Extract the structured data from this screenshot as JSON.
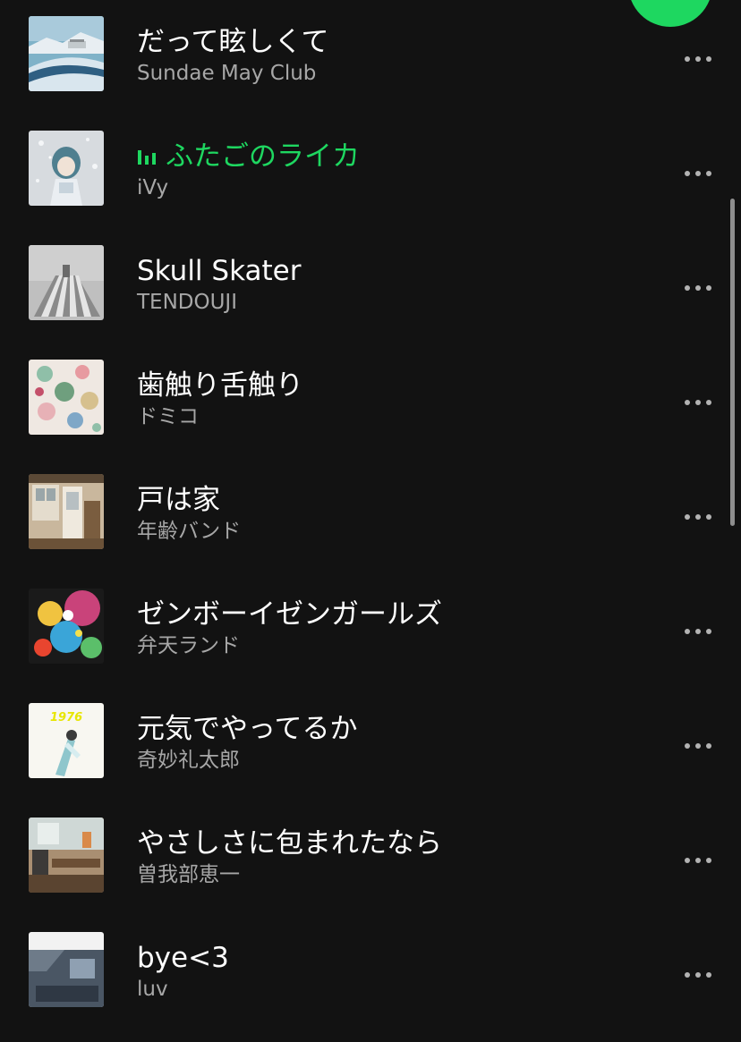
{
  "colors": {
    "background": "#121212",
    "accent": "#1ed760",
    "title": "#ffffff",
    "artist": "#a7a7a7"
  },
  "tracks": [
    {
      "title": "だって眩しくて",
      "artist": "Sundae May Club",
      "playing": false
    },
    {
      "title": "ふたごのライカ",
      "artist": "iVy",
      "playing": true
    },
    {
      "title": "Skull Skater",
      "artist": "TENDOUJI",
      "playing": false
    },
    {
      "title": "歯触り舌触り",
      "artist": "ドミコ",
      "playing": false
    },
    {
      "title": "戸は家",
      "artist": "年齢バンド",
      "playing": false
    },
    {
      "title": "ゼンボーイゼンガールズ",
      "artist": "弁天ランド",
      "playing": false
    },
    {
      "title": "元気でやってるか",
      "artist": "奇妙礼太郎",
      "playing": false
    },
    {
      "title": "やさしさに包まれたなら",
      "artist": "曽我部恵一",
      "playing": false
    },
    {
      "title": "bye<3",
      "artist": "luv",
      "playing": false
    }
  ],
  "icons": {
    "playing": "equalizer-bars-icon",
    "more": "more-dots-icon",
    "play_button": "play-button"
  },
  "cover_art": {
    "album_1_text": "1976"
  }
}
